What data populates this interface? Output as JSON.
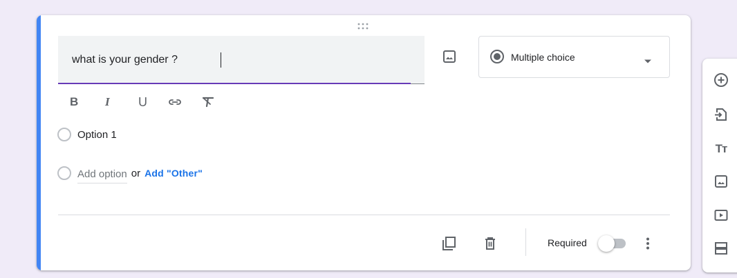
{
  "question": {
    "title_value": "what is your gender ?",
    "type_label": "Multiple choice"
  },
  "format_bar": {
    "bold": "B",
    "italic": "I",
    "underline": "U"
  },
  "options": [
    {
      "label": "Option 1"
    }
  ],
  "add_row": {
    "placeholder": "Add option",
    "or": "or",
    "add_other": "Add \"Other\""
  },
  "footer": {
    "required_label": "Required",
    "required_on": false
  },
  "side_toolbar": {
    "title_icon_text": "Tт"
  },
  "colors": {
    "accent": "#4285f4",
    "focus_underline": "#673ab7",
    "link": "#1a73e8",
    "background": "#f0ebf8"
  }
}
